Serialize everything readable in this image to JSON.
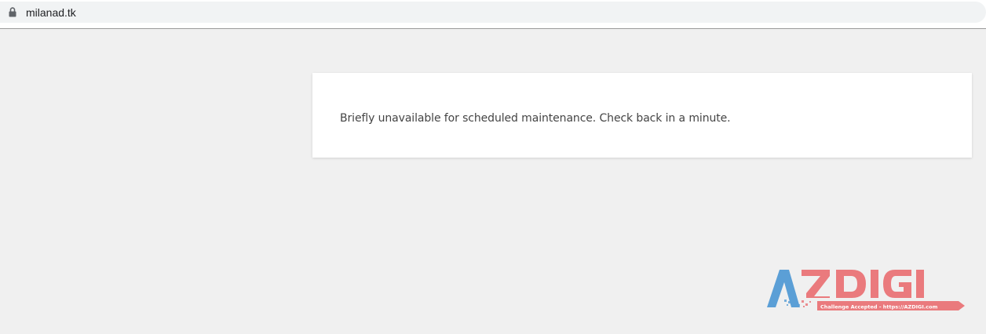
{
  "browser": {
    "url": "milanad.tk",
    "lock_icon": "lock-icon"
  },
  "page": {
    "message": "Briefly unavailable for scheduled maintenance. Check back in a minute."
  },
  "watermark": {
    "brand": "AZDIGI",
    "tagline": "Challenge Accepted - https://AZDIGI.com",
    "colors": {
      "blue": "#5b9fd6",
      "red": "#ea7a7d"
    }
  }
}
